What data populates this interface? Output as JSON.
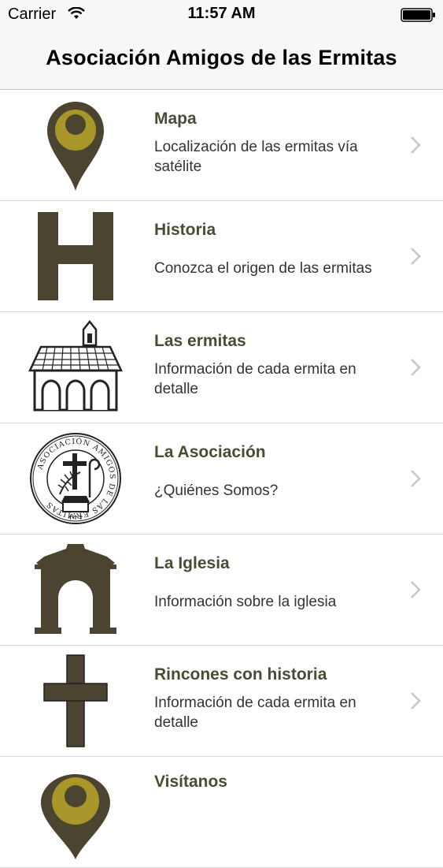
{
  "status_bar": {
    "carrier": "Carrier",
    "time": "11:57 AM"
  },
  "nav": {
    "title": "Asociación Amigos de las Ermitas"
  },
  "colors": {
    "accent": "#4a4430",
    "pin_fill": "#a8962a",
    "chevron": "#c7c7cc"
  },
  "menu": [
    {
      "title": "Mapa",
      "subtitle": "Localización de las ermitas vía satélite",
      "icon": "map-pin-icon"
    },
    {
      "title": "Historia",
      "subtitle": "Conozca el origen de las ermitas",
      "icon": "letter-h-icon"
    },
    {
      "title": "Las ermitas",
      "subtitle": "Información de cada ermita en detalle",
      "icon": "hermitage-building-icon"
    },
    {
      "title": "La Asociación",
      "subtitle": "¿Quiénes Somos?",
      "icon": "association-seal-icon"
    },
    {
      "title": "La Iglesia",
      "subtitle": "Información sobre la iglesia",
      "icon": "church-arch-icon"
    },
    {
      "title": "Rincones con historia",
      "subtitle": "Información de cada ermita en detalle",
      "icon": "cross-icon"
    },
    {
      "title": "Visítanos",
      "subtitle": "",
      "icon": "map-pin-icon"
    }
  ],
  "seal": {
    "ring_text": "ASOCIACIÓN AMIGOS DE LAS ERMITAS"
  }
}
